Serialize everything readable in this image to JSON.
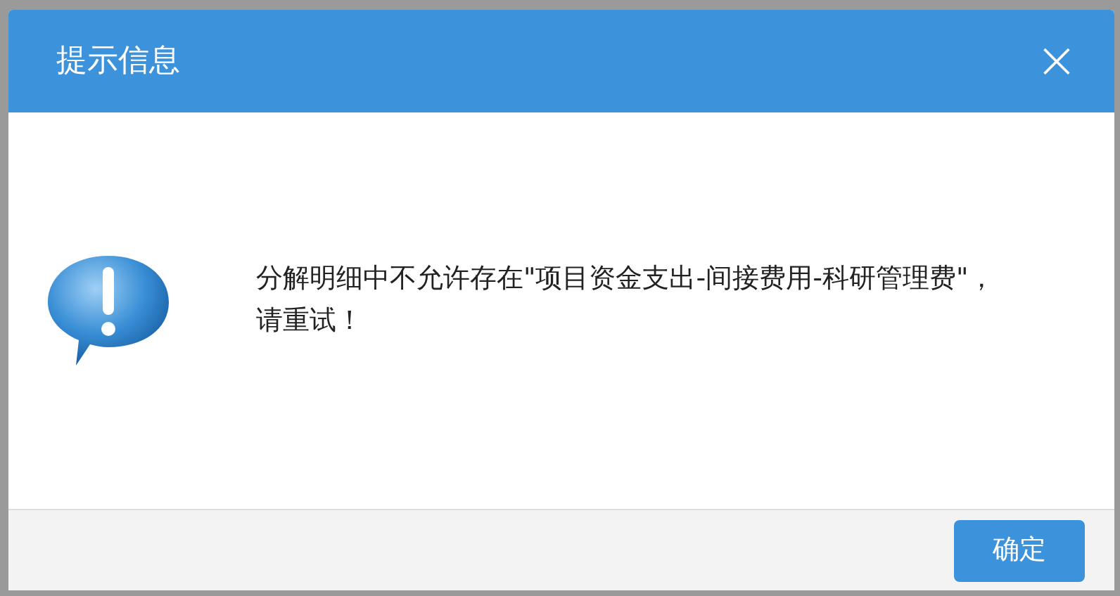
{
  "dialog": {
    "title": "提示信息",
    "close": "×",
    "message": "分解明细中不允许存在\"项目资金支出-间接费用-科研管理费\"，请重试！",
    "buttons": [
      "确定"
    ]
  }
}
